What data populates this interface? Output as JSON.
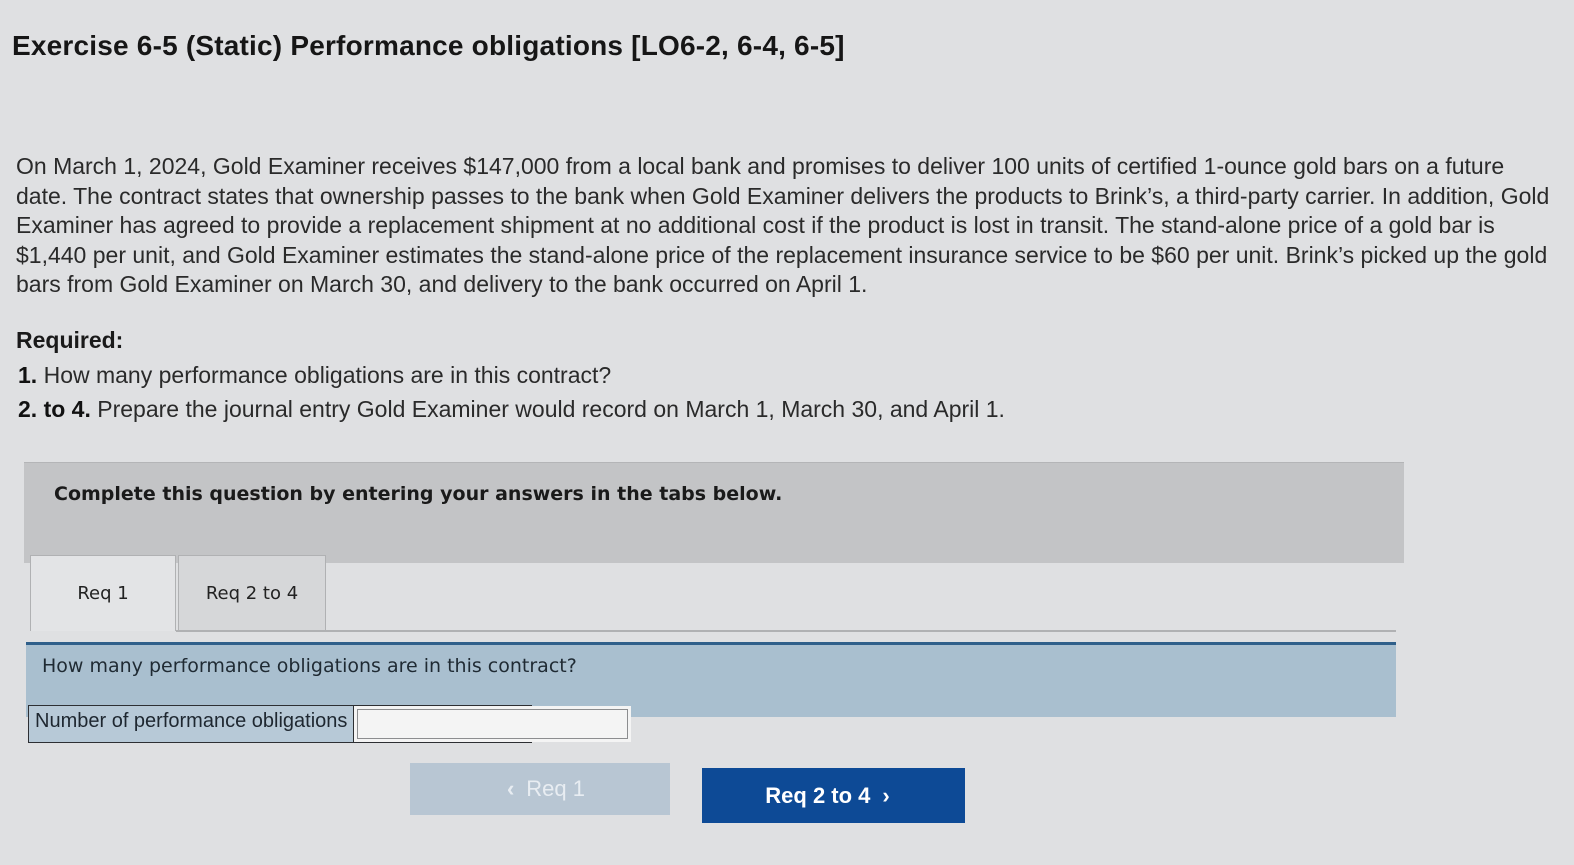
{
  "title": "Exercise 6-5 (Static) Performance obligations [LO6-2, 6-4, 6-5]",
  "problem": "On March 1, 2024, Gold Examiner receives $147,000 from a local bank and promises to deliver 100 units of certified 1-ounce gold bars on a future date. The contract states that ownership passes to the bank when Gold Examiner delivers the products to Brink’s, a third-party carrier. In addition, Gold Examiner has agreed to provide a replacement shipment at no additional cost if the product is lost in transit. The stand-alone price of a gold bar is $1,440 per unit, and Gold Examiner estimates the stand-alone price of the replacement insurance service to be $60 per unit. Brink’s picked up the gold bars from Gold Examiner on March 30, and delivery to the bank occurred on April 1.",
  "required_label": "Required:",
  "requirements": [
    {
      "num": "1.",
      "text": "How many performance obligations are in this contract?"
    },
    {
      "num": "2. to 4.",
      "text": "Prepare the journal entry Gold Examiner would record on March 1, March 30, and April 1."
    }
  ],
  "instruction": "Complete this question by entering your answers in the tabs below.",
  "tabs": [
    {
      "label": "Req 1"
    },
    {
      "label": "Req 2 to 4"
    }
  ],
  "question": "How many performance obligations are in this contract?",
  "answer": {
    "label": "Number of performance obligations",
    "value": ""
  },
  "nav": {
    "prev_label": "Req 1",
    "next_label": "Req 2 to 4",
    "prev_icon": "chevron-left-icon",
    "next_icon": "chevron-right-icon"
  },
  "colors": {
    "next_button": "#0d4a96",
    "question_bar": "#a9bfcf"
  }
}
